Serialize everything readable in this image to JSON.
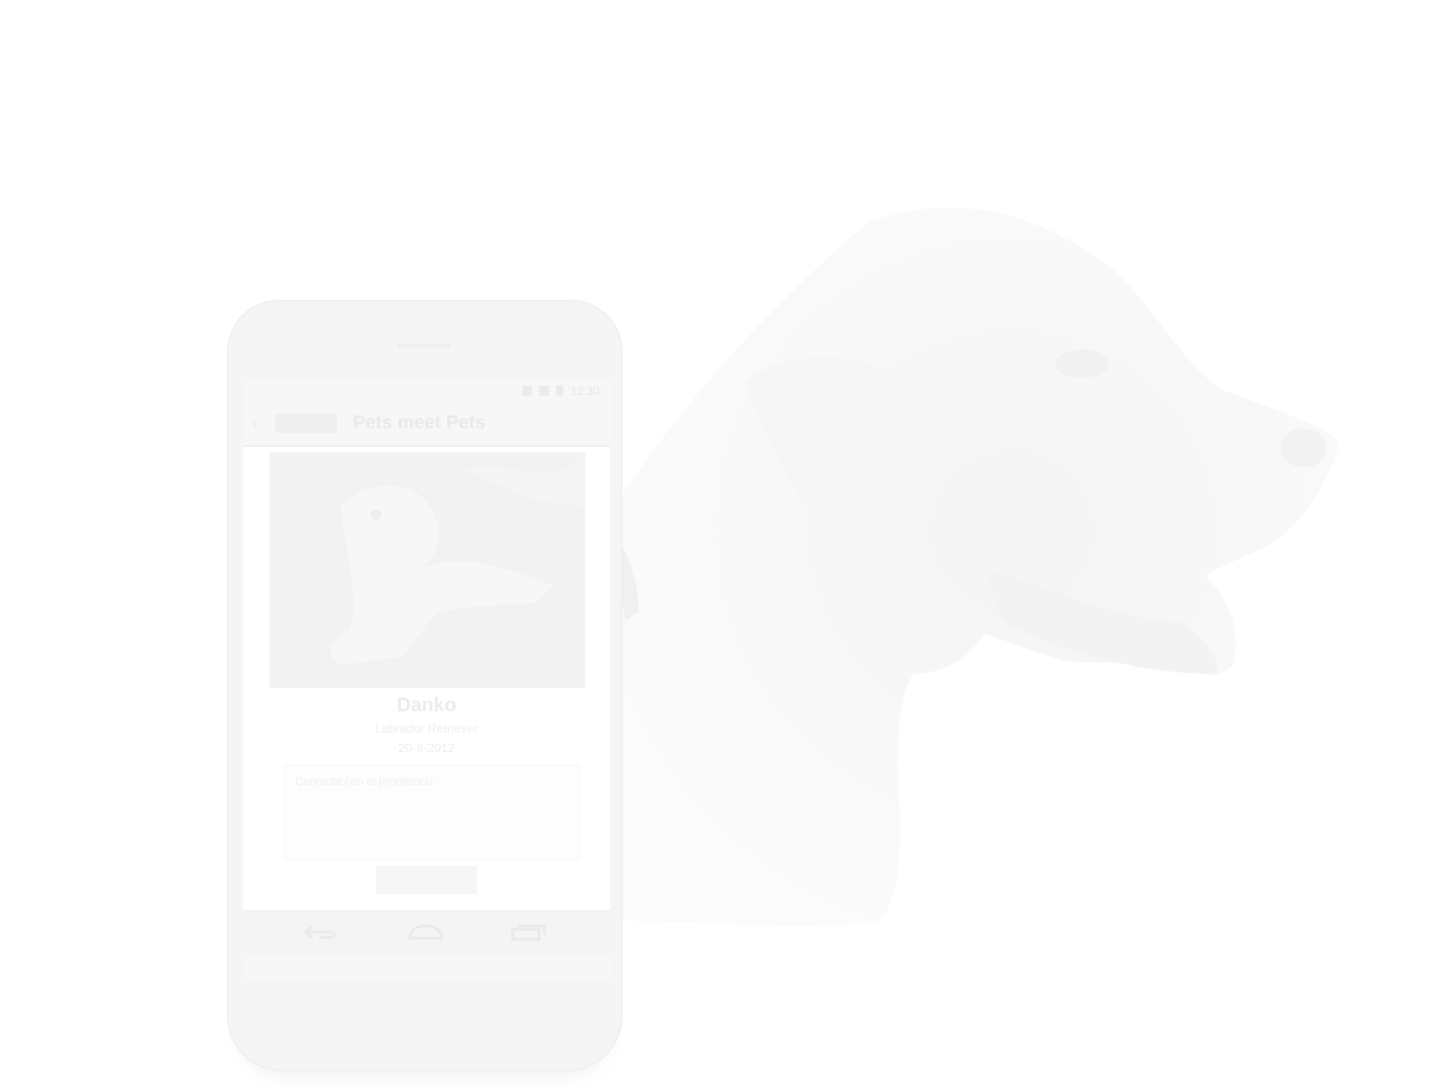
{
  "phone": {
    "status_bar": {
      "time": "12:30"
    },
    "action_bar": {
      "back_glyph": "‹",
      "title": "Pets meet Pets"
    },
    "pet": {
      "name": "Danko",
      "breed": "Labrador Retriever",
      "date": "20-8-2012",
      "photo_icon": "dog-photo"
    },
    "contact": {
      "placeholder": "Contacta con el propietario",
      "send_label": "Enviar"
    },
    "nav": {
      "back_icon": "back-icon",
      "home_icon": "home-icon",
      "recents_icon": "recents-icon"
    }
  },
  "background": {
    "image": "faded-labrador-dog"
  }
}
